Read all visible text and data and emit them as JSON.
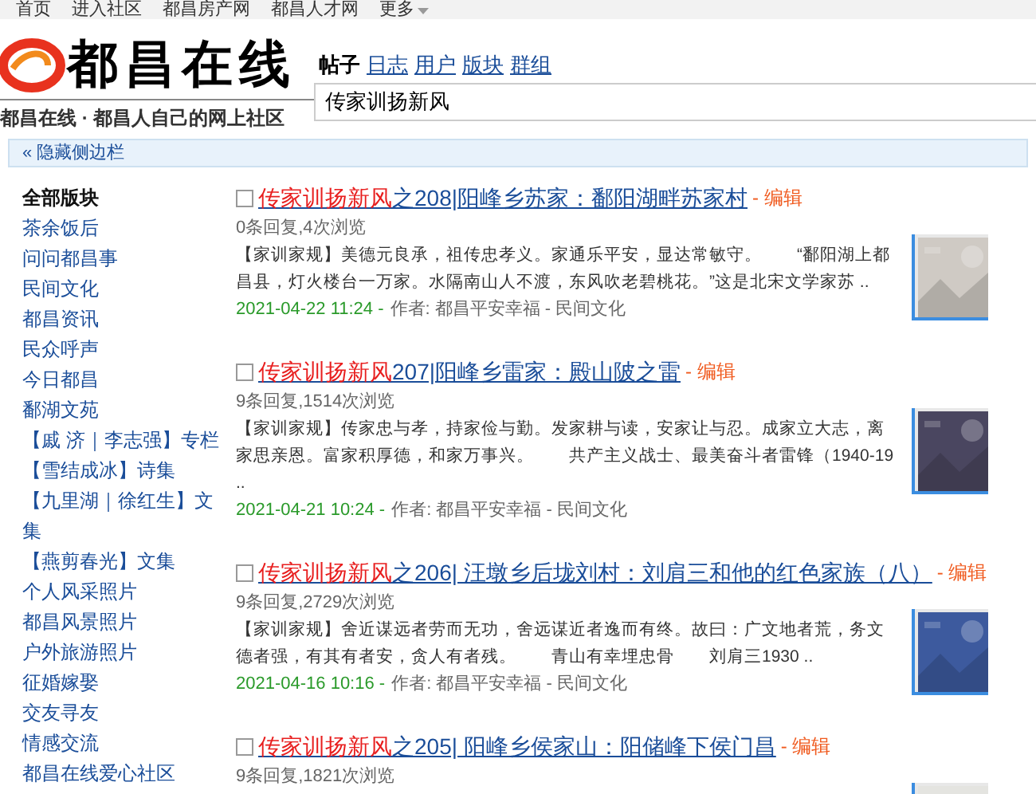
{
  "top_nav": [
    "首页",
    "进入社区",
    "都昌房产网",
    "都昌人才网",
    "更多"
  ],
  "logo": {
    "title": "都昌在线",
    "slogan": "都昌在线 · 都昌人自己的网上社区"
  },
  "search_tabs": [
    {
      "label": "帖子",
      "selected": true
    },
    {
      "label": "日志",
      "selected": false
    },
    {
      "label": "用户",
      "selected": false
    },
    {
      "label": "版块",
      "selected": false
    },
    {
      "label": "群组",
      "selected": false
    }
  ],
  "search": {
    "value": "传家训扬新风"
  },
  "sidebar_toggle": "« 隐藏侧边栏",
  "sidebar": {
    "heading": "全部版块",
    "items": [
      "茶余饭后",
      "问问都昌事",
      "民间文化",
      "都昌资讯",
      "民众呼声",
      "今日都昌",
      "鄱湖文苑",
      "【戚 济｜李志强】专栏",
      "【雪结成冰】诗集",
      "【九里湖｜徐红生】文集",
      "【燕剪春光】文集",
      "个人风采照片",
      "都昌风景照片",
      "户外旅游照片",
      "征婚嫁娶",
      "交友寻友",
      "情感交流",
      "都昌在线爱心社区"
    ]
  },
  "results": [
    {
      "keyword": "传家训扬新风",
      "title": "之208|阳峰乡苏家：鄱阳湖畔苏家村",
      "edit": "- 编辑",
      "stats": "0条回复,4次浏览",
      "excerpt": "【家训家规】美德元良承，祖传忠孝义。家通乐平安，显达常敏守。　　“鄱阳湖上都昌县，灯火楼台一万家。水隔南山人不渡，东风吹老碧桃花。”这是北宋文学家苏 ..",
      "date": "2021-04-22 11:24 -",
      "byline": "作者: 都昌平安幸福 - 民间文化",
      "checked": false
    },
    {
      "keyword": "传家训扬新风",
      "title": "207|阳峰乡雷家：殿山陂之雷",
      "edit": "- 编辑",
      "stats": "9条回复,1514次浏览",
      "excerpt": "【家训家规】传家忠与孝，持家俭与勤。发家耕与读，安家让与忍。成家立大志，离家思亲恩。富家积厚德，和家万事兴。　　共产主义战士、最美奋斗者雷锋（1940-19 ..",
      "date": "2021-04-21 10:24 -",
      "byline": "作者: 都昌平安幸福 - 民间文化",
      "checked": false
    },
    {
      "keyword": "传家训扬新风",
      "title": "之206| 汪墩乡后垅刘村：刘肩三和他的红色家族（八）",
      "edit": "- 编辑",
      "stats": "9条回复,2729次浏览",
      "excerpt": "【家训家规】舍近谋远者劳而无功，舍远谋近者逸而有终。故曰：广文地者荒，务文德者强，有其有者安，贪人有者残。　　青山有幸埋忠骨　　刘肩三1930 ..",
      "date": "2021-04-16 10:16 -",
      "byline": "作者: 都昌平安幸福 - 民间文化",
      "checked": false
    },
    {
      "keyword": "传家训扬新风",
      "title": "之205| 阳峰乡侯家山：阳储峰下侯门昌",
      "edit": "- 编辑",
      "stats": "9条回复,1821次浏览",
      "checked": false
    }
  ]
}
